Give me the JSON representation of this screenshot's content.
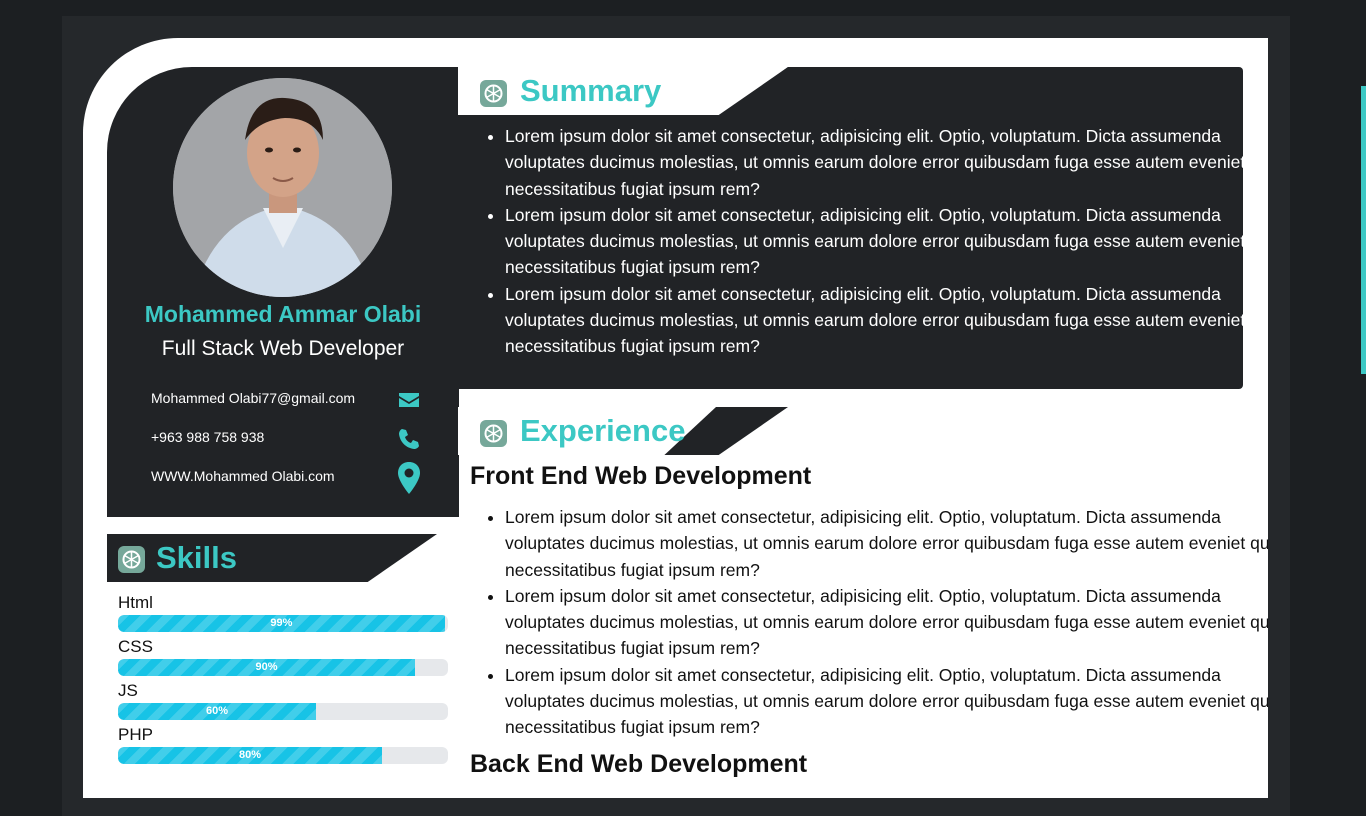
{
  "profile": {
    "name": "Mohammed Ammar Olabi",
    "role": "Full Stack Web Developer",
    "contacts": [
      {
        "text": "Mohammed Olabi77@gmail.com",
        "icon": "envelope-icon"
      },
      {
        "text": "+963 988 758 938",
        "icon": "phone-icon"
      },
      {
        "text": "WWW.Mohammed Olabi.com",
        "icon": "location-pin-icon"
      }
    ]
  },
  "skills": {
    "title": "Skills",
    "items": [
      {
        "name": "Html",
        "level": 99,
        "label": "99%"
      },
      {
        "name": "CSS",
        "level": 90,
        "label": "90%"
      },
      {
        "name": "JS",
        "level": 60,
        "label": "60%"
      },
      {
        "name": "PHP",
        "level": 80,
        "label": "80%"
      }
    ]
  },
  "summary": {
    "title": "Summary",
    "items": [
      "Lorem ipsum dolor sit amet consectetur, adipisicing elit. Optio, voluptatum. Dicta assumenda voluptates ducimus molestias, ut omnis earum dolore error quibusdam fuga esse autem eveniet quod necessitatibus fugiat ipsum rem?",
      "Lorem ipsum dolor sit amet consectetur, adipisicing elit. Optio, voluptatum. Dicta assumenda voluptates ducimus molestias, ut omnis earum dolore error quibusdam fuga esse autem eveniet quod necessitatibus fugiat ipsum rem?",
      "Lorem ipsum dolor sit amet consectetur, adipisicing elit. Optio, voluptatum. Dicta assumenda voluptates ducimus molestias, ut omnis earum dolore error quibusdam fuga esse autem eveniet quod necessitatibus fugiat ipsum rem?"
    ]
  },
  "experience": {
    "title": "Experience",
    "jobs": [
      {
        "title": "Front End Web Development",
        "items": [
          "Lorem ipsum dolor sit amet consectetur, adipisicing elit. Optio, voluptatum. Dicta assumenda voluptates ducimus molestias, ut omnis earum dolore error quibusdam fuga esse autem eveniet quod necessitatibus fugiat ipsum rem?",
          "Lorem ipsum dolor sit amet consectetur, adipisicing elit. Optio, voluptatum. Dicta assumenda voluptates ducimus molestias, ut omnis earum dolore error quibusdam fuga esse autem eveniet quod necessitatibus fugiat ipsum rem?",
          "Lorem ipsum dolor sit amet consectetur, adipisicing elit. Optio, voluptatum. Dicta assumenda voluptates ducimus molestias, ut omnis earum dolore error quibusdam fuga esse autem eveniet quod necessitatibus fugiat ipsum rem?"
        ]
      },
      {
        "title": "Back End Web Development",
        "items": []
      }
    ]
  },
  "colors": {
    "accent": "#3cc8c4",
    "dark_panel": "#212326",
    "bar_fill": "#17c3e6"
  }
}
